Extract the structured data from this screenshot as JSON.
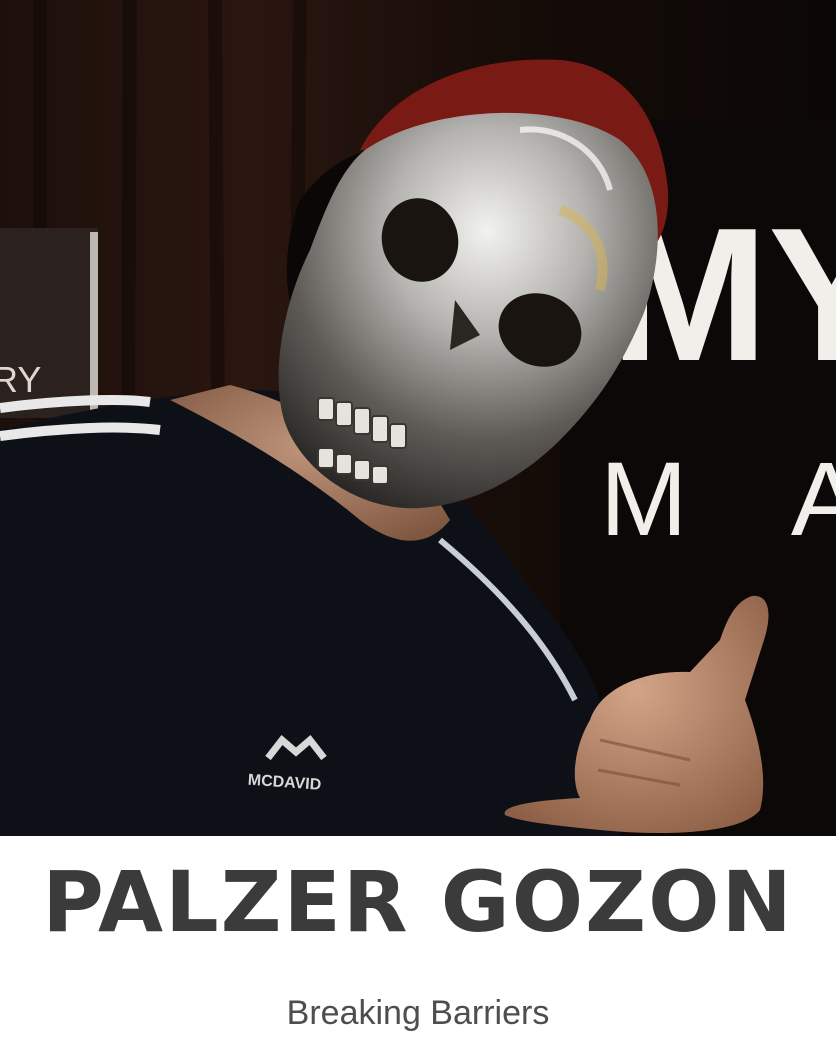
{
  "photo": {
    "subject": "skull-mask-portrait",
    "background_letters_row1": "MY",
    "background_letters_row2": "M A",
    "poster_text": "RY",
    "shirt_logo": "MCDAVID"
  },
  "caption": {
    "name": "PALZER GOZON",
    "subtitle": "Breaking Barriers"
  },
  "colors": {
    "background": "#ffffff",
    "name_text": "#3b3b3b",
    "subtitle_text": "#4e4e4e",
    "backdrop": "#120b09",
    "beanie": "#7a1a14",
    "mask_silver": "#b9b6b2",
    "shirt": "#0d1016"
  }
}
